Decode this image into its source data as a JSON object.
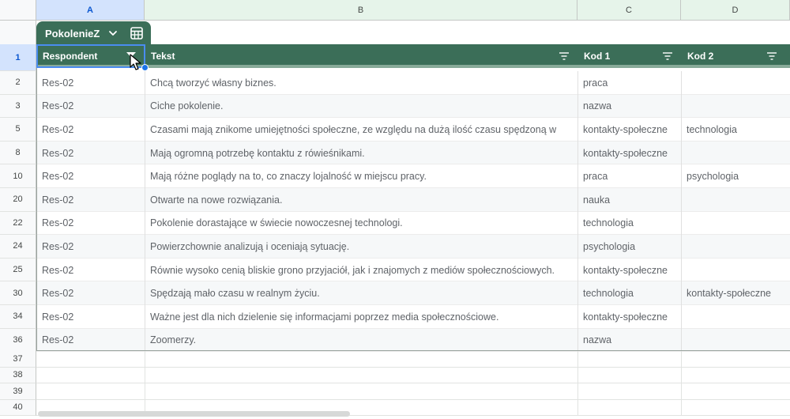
{
  "columns": [
    "A",
    "B",
    "C",
    "D"
  ],
  "table": {
    "name": "PokolenieZ",
    "headers": [
      "Respondent",
      "Tekst",
      "Kod 1",
      "Kod 2"
    ],
    "header_row_number": "1",
    "rows": [
      {
        "num": "2",
        "respondent": "Res-02",
        "tekst": "Chcą tworzyć własny biznes.",
        "kod1": "praca",
        "kod2": ""
      },
      {
        "num": "3",
        "respondent": "Res-02",
        "tekst": "Ciche pokolenie.",
        "kod1": "nazwa",
        "kod2": ""
      },
      {
        "num": "5",
        "respondent": "Res-02",
        "tekst": "Czasami mają znikome umiejętności społeczne, ze względu na dużą ilość czasu spędzoną w",
        "kod1": "kontakty-społeczne",
        "kod2": "technologia"
      },
      {
        "num": "8",
        "respondent": "Res-02",
        "tekst": "Mają ogromną potrzebę kontaktu z rówieśnikami.",
        "kod1": "kontakty-społeczne",
        "kod2": ""
      },
      {
        "num": "10",
        "respondent": "Res-02",
        "tekst": "Mają różne poglądy na to, co znaczy lojalność w miejscu pracy.",
        "kod1": "praca",
        "kod2": "psychologia"
      },
      {
        "num": "20",
        "respondent": "Res-02",
        "tekst": "Otwarte na nowe rozwiązania.",
        "kod1": "nauka",
        "kod2": ""
      },
      {
        "num": "22",
        "respondent": "Res-02",
        "tekst": "Pokolenie dorastające w świecie nowoczesnej technologi.",
        "kod1": "technologia",
        "kod2": ""
      },
      {
        "num": "24",
        "respondent": "Res-02",
        "tekst": "Powierzchownie analizują i oceniają sytuację.",
        "kod1": "psychologia",
        "kod2": ""
      },
      {
        "num": "25",
        "respondent": "Res-02",
        "tekst": "Równie wysoko cenią bliskie grono przyjaciół, jak i znajomych z mediów społecznościowych.",
        "kod1": "kontakty-społeczne",
        "kod2": ""
      },
      {
        "num": "30",
        "respondent": "Res-02",
        "tekst": "Spędzają mało czasu w realnym życiu.",
        "kod1": "technologia",
        "kod2": "kontakty-społeczne"
      },
      {
        "num": "34",
        "respondent": "Res-02",
        "tekst": "Ważne jest dla nich dzielenie się informacjami poprzez media społecznościowe.",
        "kod1": "kontakty-społeczne",
        "kod2": ""
      },
      {
        "num": "36",
        "respondent": "Res-02",
        "tekst": "Zoomerzy.",
        "kod1": "nazwa",
        "kod2": ""
      }
    ]
  },
  "empty_rows": [
    "37",
    "38",
    "39",
    "40"
  ],
  "colors": {
    "table_header": "#3b6e58",
    "selection": "#4a8cf0",
    "column_header_bg": "#e6f4ea"
  },
  "icons": {
    "dropdown": "chevron-down-icon",
    "table": "table-icon",
    "filter": "filter-icon",
    "cursor": "mouse-pointer-icon"
  }
}
